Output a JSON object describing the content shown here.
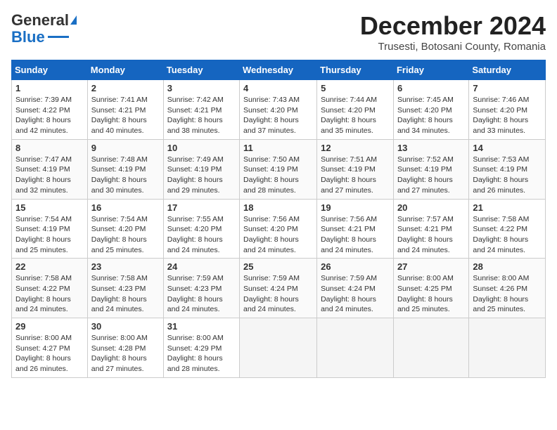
{
  "header": {
    "logo_general": "General",
    "logo_blue": "Blue",
    "month_title": "December 2024",
    "location": "Trusesti, Botosani County, Romania"
  },
  "days_of_week": [
    "Sunday",
    "Monday",
    "Tuesday",
    "Wednesday",
    "Thursday",
    "Friday",
    "Saturday"
  ],
  "weeks": [
    [
      {
        "day": "1",
        "lines": [
          "Sunrise: 7:39 AM",
          "Sunset: 4:22 PM",
          "Daylight: 8 hours",
          "and 42 minutes."
        ]
      },
      {
        "day": "2",
        "lines": [
          "Sunrise: 7:41 AM",
          "Sunset: 4:21 PM",
          "Daylight: 8 hours",
          "and 40 minutes."
        ]
      },
      {
        "day": "3",
        "lines": [
          "Sunrise: 7:42 AM",
          "Sunset: 4:21 PM",
          "Daylight: 8 hours",
          "and 38 minutes."
        ]
      },
      {
        "day": "4",
        "lines": [
          "Sunrise: 7:43 AM",
          "Sunset: 4:20 PM",
          "Daylight: 8 hours",
          "and 37 minutes."
        ]
      },
      {
        "day": "5",
        "lines": [
          "Sunrise: 7:44 AM",
          "Sunset: 4:20 PM",
          "Daylight: 8 hours",
          "and 35 minutes."
        ]
      },
      {
        "day": "6",
        "lines": [
          "Sunrise: 7:45 AM",
          "Sunset: 4:20 PM",
          "Daylight: 8 hours",
          "and 34 minutes."
        ]
      },
      {
        "day": "7",
        "lines": [
          "Sunrise: 7:46 AM",
          "Sunset: 4:20 PM",
          "Daylight: 8 hours",
          "and 33 minutes."
        ]
      }
    ],
    [
      {
        "day": "8",
        "lines": [
          "Sunrise: 7:47 AM",
          "Sunset: 4:19 PM",
          "Daylight: 8 hours",
          "and 32 minutes."
        ]
      },
      {
        "day": "9",
        "lines": [
          "Sunrise: 7:48 AM",
          "Sunset: 4:19 PM",
          "Daylight: 8 hours",
          "and 30 minutes."
        ]
      },
      {
        "day": "10",
        "lines": [
          "Sunrise: 7:49 AM",
          "Sunset: 4:19 PM",
          "Daylight: 8 hours",
          "and 29 minutes."
        ]
      },
      {
        "day": "11",
        "lines": [
          "Sunrise: 7:50 AM",
          "Sunset: 4:19 PM",
          "Daylight: 8 hours",
          "and 28 minutes."
        ]
      },
      {
        "day": "12",
        "lines": [
          "Sunrise: 7:51 AM",
          "Sunset: 4:19 PM",
          "Daylight: 8 hours",
          "and 27 minutes."
        ]
      },
      {
        "day": "13",
        "lines": [
          "Sunrise: 7:52 AM",
          "Sunset: 4:19 PM",
          "Daylight: 8 hours",
          "and 27 minutes."
        ]
      },
      {
        "day": "14",
        "lines": [
          "Sunrise: 7:53 AM",
          "Sunset: 4:19 PM",
          "Daylight: 8 hours",
          "and 26 minutes."
        ]
      }
    ],
    [
      {
        "day": "15",
        "lines": [
          "Sunrise: 7:54 AM",
          "Sunset: 4:19 PM",
          "Daylight: 8 hours",
          "and 25 minutes."
        ]
      },
      {
        "day": "16",
        "lines": [
          "Sunrise: 7:54 AM",
          "Sunset: 4:20 PM",
          "Daylight: 8 hours",
          "and 25 minutes."
        ]
      },
      {
        "day": "17",
        "lines": [
          "Sunrise: 7:55 AM",
          "Sunset: 4:20 PM",
          "Daylight: 8 hours",
          "and 24 minutes."
        ]
      },
      {
        "day": "18",
        "lines": [
          "Sunrise: 7:56 AM",
          "Sunset: 4:20 PM",
          "Daylight: 8 hours",
          "and 24 minutes."
        ]
      },
      {
        "day": "19",
        "lines": [
          "Sunrise: 7:56 AM",
          "Sunset: 4:21 PM",
          "Daylight: 8 hours",
          "and 24 minutes."
        ]
      },
      {
        "day": "20",
        "lines": [
          "Sunrise: 7:57 AM",
          "Sunset: 4:21 PM",
          "Daylight: 8 hours",
          "and 24 minutes."
        ]
      },
      {
        "day": "21",
        "lines": [
          "Sunrise: 7:58 AM",
          "Sunset: 4:22 PM",
          "Daylight: 8 hours",
          "and 24 minutes."
        ]
      }
    ],
    [
      {
        "day": "22",
        "lines": [
          "Sunrise: 7:58 AM",
          "Sunset: 4:22 PM",
          "Daylight: 8 hours",
          "and 24 minutes."
        ]
      },
      {
        "day": "23",
        "lines": [
          "Sunrise: 7:58 AM",
          "Sunset: 4:23 PM",
          "Daylight: 8 hours",
          "and 24 minutes."
        ]
      },
      {
        "day": "24",
        "lines": [
          "Sunrise: 7:59 AM",
          "Sunset: 4:23 PM",
          "Daylight: 8 hours",
          "and 24 minutes."
        ]
      },
      {
        "day": "25",
        "lines": [
          "Sunrise: 7:59 AM",
          "Sunset: 4:24 PM",
          "Daylight: 8 hours",
          "and 24 minutes."
        ]
      },
      {
        "day": "26",
        "lines": [
          "Sunrise: 7:59 AM",
          "Sunset: 4:24 PM",
          "Daylight: 8 hours",
          "and 24 minutes."
        ]
      },
      {
        "day": "27",
        "lines": [
          "Sunrise: 8:00 AM",
          "Sunset: 4:25 PM",
          "Daylight: 8 hours",
          "and 25 minutes."
        ]
      },
      {
        "day": "28",
        "lines": [
          "Sunrise: 8:00 AM",
          "Sunset: 4:26 PM",
          "Daylight: 8 hours",
          "and 25 minutes."
        ]
      }
    ],
    [
      {
        "day": "29",
        "lines": [
          "Sunrise: 8:00 AM",
          "Sunset: 4:27 PM",
          "Daylight: 8 hours",
          "and 26 minutes."
        ]
      },
      {
        "day": "30",
        "lines": [
          "Sunrise: 8:00 AM",
          "Sunset: 4:28 PM",
          "Daylight: 8 hours",
          "and 27 minutes."
        ]
      },
      {
        "day": "31",
        "lines": [
          "Sunrise: 8:00 AM",
          "Sunset: 4:29 PM",
          "Daylight: 8 hours",
          "and 28 minutes."
        ]
      },
      {
        "day": "",
        "lines": []
      },
      {
        "day": "",
        "lines": []
      },
      {
        "day": "",
        "lines": []
      },
      {
        "day": "",
        "lines": []
      }
    ]
  ]
}
